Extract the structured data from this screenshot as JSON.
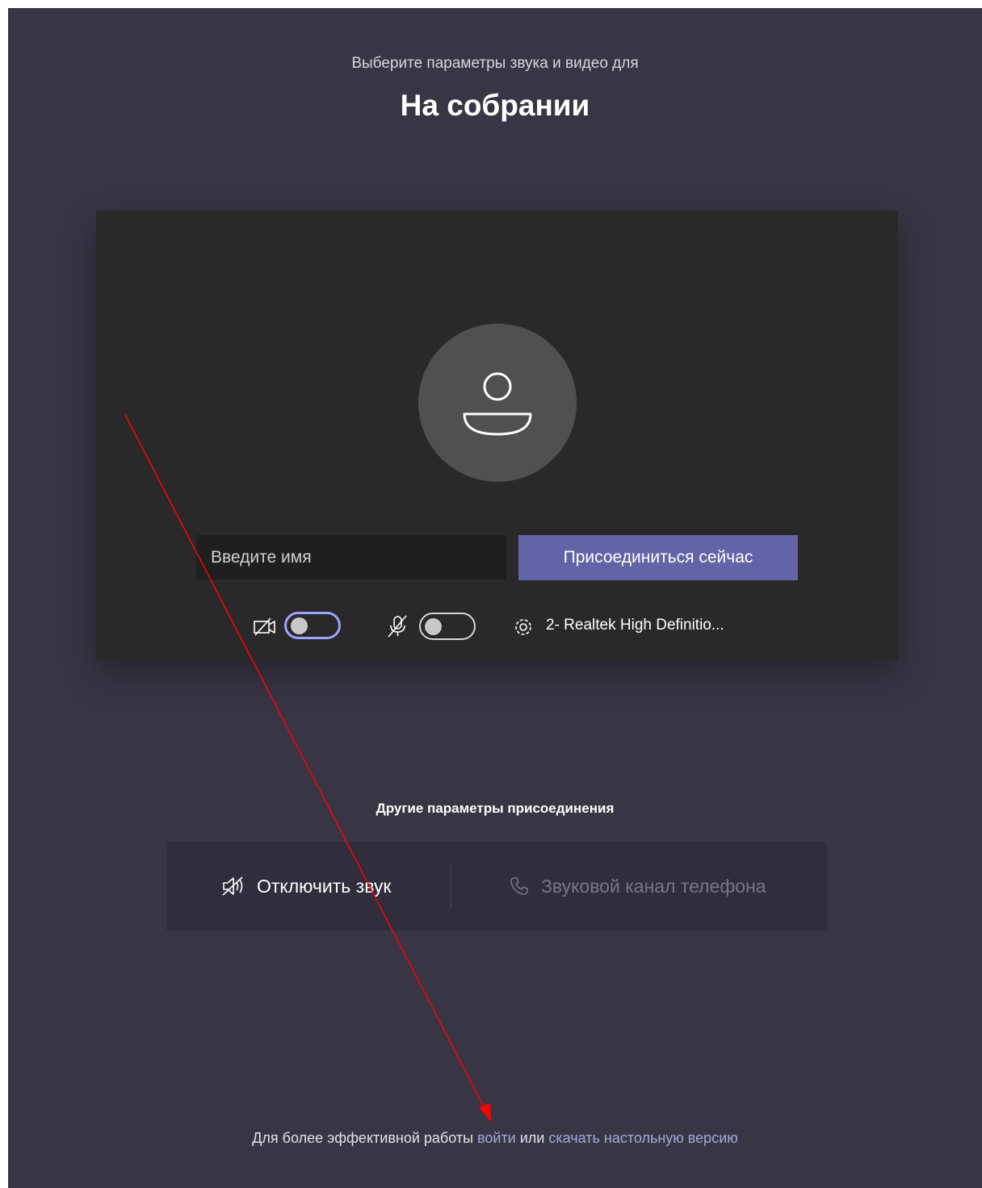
{
  "header": {
    "subtitle": "Выберите параметры звука и видео для",
    "title": "На собрании"
  },
  "prejoin": {
    "name_placeholder": "Введите имя",
    "join_label": "Присоединиться сейчас",
    "video_toggle_on": false,
    "mic_toggle_on": false,
    "audio_device": "2- Realtek High Definitio..."
  },
  "other_options": {
    "heading": "Другие параметры присоединения",
    "mute_label": "Отключить звук",
    "phone_label": "Звуковой канал телефона"
  },
  "footer": {
    "prefix": "Для более эффективной работы ",
    "signin_link": "войти",
    "middle": " или ",
    "download_link": "скачать настольную версию"
  },
  "colors": {
    "background": "#383645",
    "accent": "#6264a7",
    "link": "#a6a7dc",
    "annotation_arrow": "#ff0000"
  }
}
